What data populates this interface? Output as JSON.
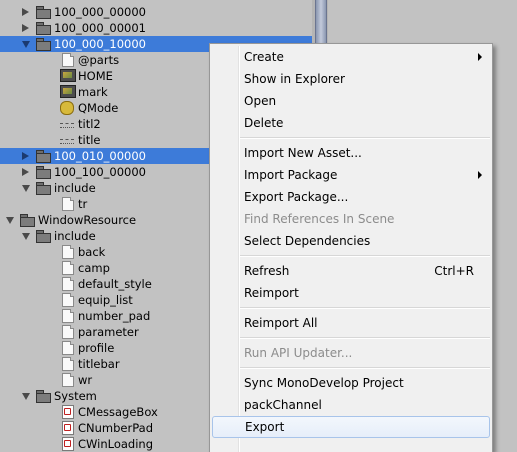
{
  "tree": [
    {
      "label": "100_000_00000",
      "icon": "folder-icon",
      "arrow": "collapsed",
      "indent": 36,
      "selected": false
    },
    {
      "label": "100_000_00001",
      "icon": "folder-icon",
      "arrow": "collapsed",
      "indent": 36,
      "selected": false
    },
    {
      "label": "100_000_10000",
      "icon": "folder-icon",
      "arrow": "expanded",
      "indent": 36,
      "selected": true
    },
    {
      "label": "@parts",
      "icon": "file-icon",
      "arrow": "none",
      "indent": 60,
      "selected": false
    },
    {
      "label": "HOME",
      "icon": "image-icon",
      "arrow": "none",
      "indent": 60,
      "selected": false
    },
    {
      "label": "mark",
      "icon": "image-icon",
      "arrow": "none",
      "indent": 60,
      "selected": false
    },
    {
      "label": "QMode",
      "icon": "coin-icon",
      "arrow": "none",
      "indent": 60,
      "selected": false
    },
    {
      "label": "titl2",
      "icon": "line-icon",
      "arrow": "none",
      "indent": 60,
      "selected": false
    },
    {
      "label": "title",
      "icon": "line-icon",
      "arrow": "none",
      "indent": 60,
      "selected": false
    },
    {
      "label": "100_010_00000",
      "icon": "folder-icon",
      "arrow": "collapsed",
      "indent": 36,
      "selected": true
    },
    {
      "label": "100_100_00000",
      "icon": "folder-icon",
      "arrow": "collapsed",
      "indent": 36,
      "selected": false
    },
    {
      "label": "include",
      "icon": "folder-icon",
      "arrow": "expanded",
      "indent": 36,
      "selected": false
    },
    {
      "label": "tr",
      "icon": "file-icon",
      "arrow": "none",
      "indent": 60,
      "selected": false
    },
    {
      "label": "WindowResource",
      "icon": "folder-icon",
      "arrow": "expanded",
      "indent": 20,
      "selected": false
    },
    {
      "label": "include",
      "icon": "folder-icon",
      "arrow": "expanded",
      "indent": 36,
      "selected": false
    },
    {
      "label": "back",
      "icon": "file-icon",
      "arrow": "none",
      "indent": 60,
      "selected": false
    },
    {
      "label": "camp",
      "icon": "file-icon",
      "arrow": "none",
      "indent": 60,
      "selected": false
    },
    {
      "label": "default_style",
      "icon": "file-icon",
      "arrow": "none",
      "indent": 60,
      "selected": false
    },
    {
      "label": "equip_list",
      "icon": "file-icon",
      "arrow": "none",
      "indent": 60,
      "selected": false
    },
    {
      "label": "number_pad",
      "icon": "file-icon",
      "arrow": "none",
      "indent": 60,
      "selected": false
    },
    {
      "label": "parameter",
      "icon": "file-icon",
      "arrow": "none",
      "indent": 60,
      "selected": false
    },
    {
      "label": "profile",
      "icon": "file-icon",
      "arrow": "none",
      "indent": 60,
      "selected": false
    },
    {
      "label": "titlebar",
      "icon": "file-icon",
      "arrow": "none",
      "indent": 60,
      "selected": false
    },
    {
      "label": "wr",
      "icon": "file-icon",
      "arrow": "none",
      "indent": 60,
      "selected": false
    },
    {
      "label": "System",
      "icon": "folder-icon",
      "arrow": "expanded",
      "indent": 36,
      "selected": false
    },
    {
      "label": "CMessageBox",
      "icon": "script-icon",
      "arrow": "none",
      "indent": 60,
      "selected": false
    },
    {
      "label": "CNumberPad",
      "icon": "script-icon",
      "arrow": "none",
      "indent": 60,
      "selected": false
    },
    {
      "label": "CWinLoading",
      "icon": "script-icon",
      "arrow": "none",
      "indent": 60,
      "selected": false
    }
  ],
  "menu": {
    "items": [
      {
        "label": "Create",
        "shortcut": "",
        "submenu": true,
        "disabled": false,
        "highlighted": false,
        "name": "menu-item-create"
      },
      {
        "label": "Show in Explorer",
        "shortcut": "",
        "submenu": false,
        "disabled": false,
        "highlighted": false,
        "name": "menu-item-show-in-explorer"
      },
      {
        "label": "Open",
        "shortcut": "",
        "submenu": false,
        "disabled": false,
        "highlighted": false,
        "name": "menu-item-open"
      },
      {
        "label": "Delete",
        "shortcut": "",
        "submenu": false,
        "disabled": false,
        "highlighted": false,
        "name": "menu-item-delete"
      },
      {
        "sep": true
      },
      {
        "label": "Import New Asset...",
        "shortcut": "",
        "submenu": false,
        "disabled": false,
        "highlighted": false,
        "name": "menu-item-import-new-asset"
      },
      {
        "label": "Import Package",
        "shortcut": "",
        "submenu": true,
        "disabled": false,
        "highlighted": false,
        "name": "menu-item-import-package"
      },
      {
        "label": "Export Package...",
        "shortcut": "",
        "submenu": false,
        "disabled": false,
        "highlighted": false,
        "name": "menu-item-export-package"
      },
      {
        "label": "Find References In Scene",
        "shortcut": "",
        "submenu": false,
        "disabled": true,
        "highlighted": false,
        "name": "menu-item-find-references"
      },
      {
        "label": "Select Dependencies",
        "shortcut": "",
        "submenu": false,
        "disabled": false,
        "highlighted": false,
        "name": "menu-item-select-dependencies"
      },
      {
        "sep": true
      },
      {
        "label": "Refresh",
        "shortcut": "Ctrl+R",
        "submenu": false,
        "disabled": false,
        "highlighted": false,
        "name": "menu-item-refresh"
      },
      {
        "label": "Reimport",
        "shortcut": "",
        "submenu": false,
        "disabled": false,
        "highlighted": false,
        "name": "menu-item-reimport"
      },
      {
        "sep": true
      },
      {
        "label": "Reimport All",
        "shortcut": "",
        "submenu": false,
        "disabled": false,
        "highlighted": false,
        "name": "menu-item-reimport-all"
      },
      {
        "sep": true
      },
      {
        "label": "Run API Updater...",
        "shortcut": "",
        "submenu": false,
        "disabled": true,
        "highlighted": false,
        "name": "menu-item-run-api-updater"
      },
      {
        "sep": true
      },
      {
        "label": "Sync MonoDevelop Project",
        "shortcut": "",
        "submenu": false,
        "disabled": false,
        "highlighted": false,
        "name": "menu-item-sync-monodevelop"
      },
      {
        "label": "packChannel",
        "shortcut": "",
        "submenu": false,
        "disabled": false,
        "highlighted": false,
        "name": "menu-item-packchannel"
      },
      {
        "label": "Export",
        "shortcut": "",
        "submenu": false,
        "disabled": false,
        "highlighted": true,
        "name": "menu-item-export"
      }
    ]
  },
  "colors": {
    "selection": "#3d7bd9",
    "panel": "#c2c2c2",
    "menu_bg": "#f0f0f0",
    "disabled_text": "#8c8c8c"
  }
}
